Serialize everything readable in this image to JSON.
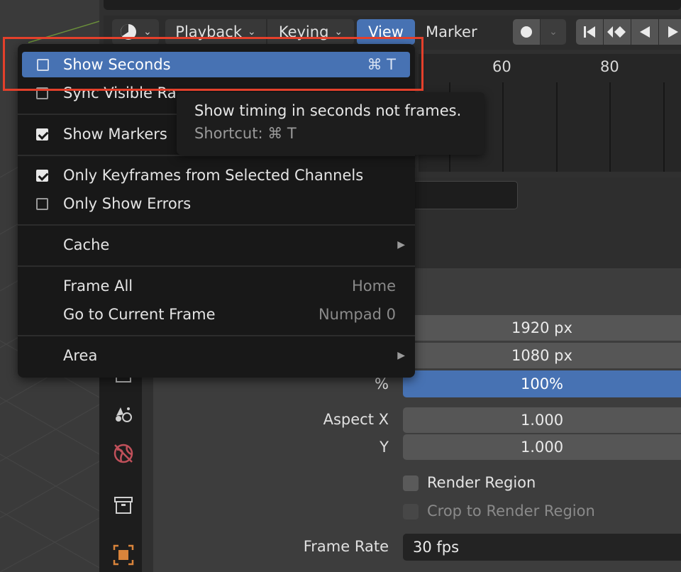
{
  "header": {
    "playback_label": "Playback",
    "keying_label": "Keying",
    "view_label": "View",
    "marker_label": "Marker"
  },
  "timeline": {
    "frames": [
      "60",
      "80"
    ]
  },
  "view_menu": {
    "items": [
      {
        "label": "Show Seconds",
        "shortcut": "⌘ T",
        "checked": false,
        "highlighted": true
      },
      {
        "label": "Sync Visible Ra",
        "checked": false
      },
      {
        "label": "Show Markers",
        "checked": true
      },
      {
        "label": "Only Keyframes from Selected Channels",
        "checked": true
      },
      {
        "label": "Only Show Errors",
        "checked": false
      },
      {
        "label": "Cache",
        "submenu": true
      },
      {
        "label": "Frame All",
        "shortcut": "Home"
      },
      {
        "label": "Go to Current Frame",
        "shortcut": "Numpad 0"
      },
      {
        "label": "Area",
        "submenu": true
      }
    ]
  },
  "tooltip": {
    "description": "Show timing in seconds not frames.",
    "shortcut": "Shortcut: ⌘ T"
  },
  "properties": {
    "resolution_x": "1920 px",
    "resolution_y": "1080 px",
    "percent_label": "%",
    "percent_value": "100%",
    "aspect_x_label": "Aspect X",
    "aspect_x_value": "1.000",
    "aspect_y_label": "Y",
    "aspect_y_value": "1.000",
    "render_region_label": "Render Region",
    "crop_label": "Crop to Render Region",
    "frame_rate_label": "Frame Rate",
    "frame_rate_value": "30 fps"
  },
  "colors": {
    "accent": "#4772b3",
    "highlight_box": "#e4402b",
    "menu_bg": "#181818"
  }
}
